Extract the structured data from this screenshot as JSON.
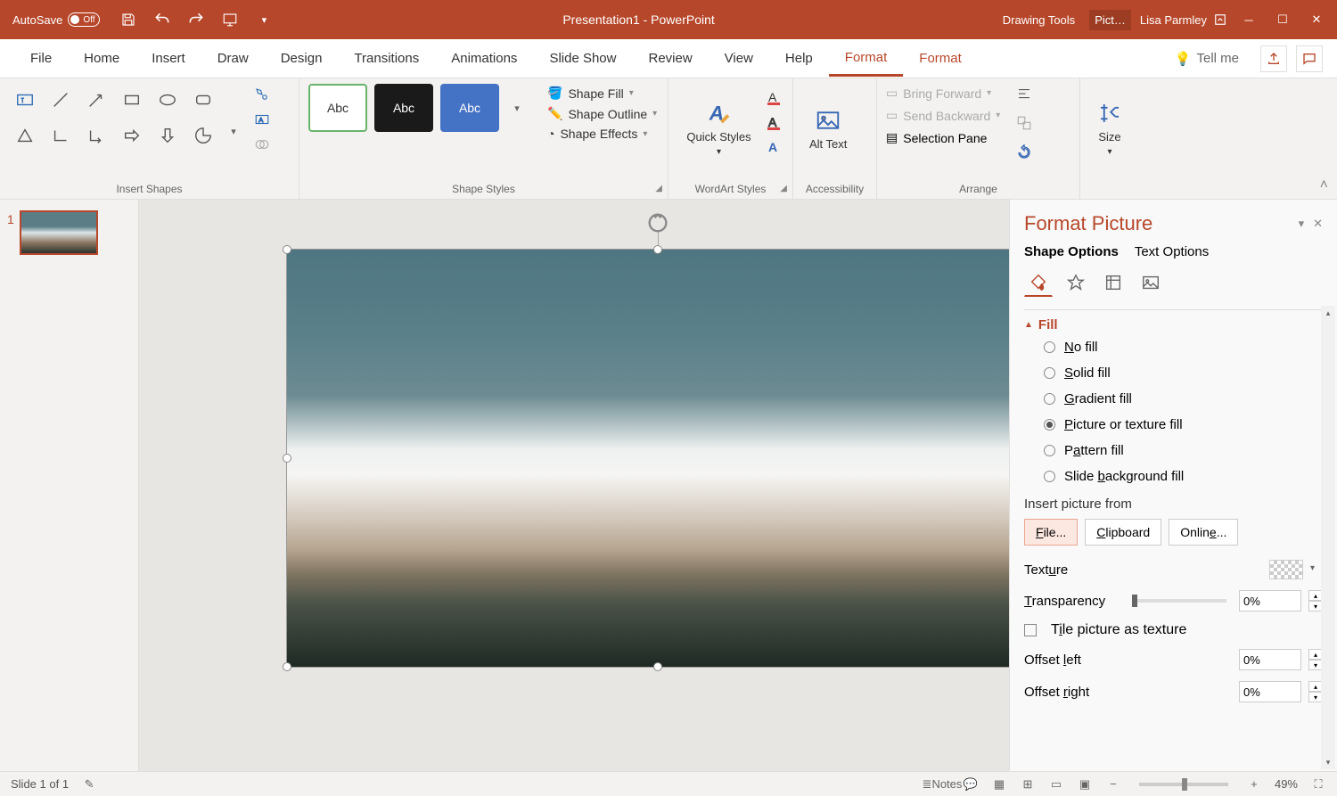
{
  "titlebar": {
    "autosave": "AutoSave",
    "autosave_state": "Off",
    "title": "Presentation1  -  PowerPoint",
    "tools1": "Drawing Tools",
    "tools2": "Pict…",
    "user": "Lisa Parmley"
  },
  "tabs": {
    "file": "File",
    "home": "Home",
    "insert": "Insert",
    "draw": "Draw",
    "design": "Design",
    "transitions": "Transitions",
    "animations": "Animations",
    "slideshow": "Slide Show",
    "review": "Review",
    "view": "View",
    "help": "Help",
    "format1": "Format",
    "format2": "Format",
    "tellme": "Tell me"
  },
  "ribbon": {
    "insert_shapes": "Insert Shapes",
    "shape_styles": "Shape Styles",
    "abc": "Abc",
    "shape_fill": "Shape Fill",
    "shape_outline": "Shape Outline",
    "shape_effects": "Shape Effects",
    "wordart": "WordArt Styles",
    "quick_styles": "Quick Styles",
    "accessibility": "Accessibility",
    "alt_text": "Alt Text",
    "arrange": "Arrange",
    "bring_forward": "Bring Forward",
    "send_backward": "Send Backward",
    "selection_pane": "Selection Pane",
    "size": "Size"
  },
  "thumbs": {
    "n1": "1"
  },
  "panel": {
    "title": "Format Picture",
    "shape_options": "Shape Options",
    "text_options": "Text Options",
    "fill": "Fill",
    "no_fill": "No fill",
    "solid_fill": "Solid fill",
    "gradient_fill": "Gradient fill",
    "picture_fill": "Picture or texture fill",
    "pattern_fill": "Pattern fill",
    "slide_bg": "Slide background fill",
    "insert_from": "Insert picture from",
    "file": "File...",
    "clipboard": "Clipboard",
    "online": "Online...",
    "texture": "Texture",
    "transparency": "Transparency",
    "transparency_val": "0%",
    "tile": "Tile picture as texture",
    "offset_left": "Offset left",
    "offset_left_val": "0%",
    "offset_right": "Offset right",
    "offset_right_val": "0%"
  },
  "status": {
    "slide": "Slide 1 of 1",
    "notes": "Notes",
    "zoom": "49%"
  }
}
